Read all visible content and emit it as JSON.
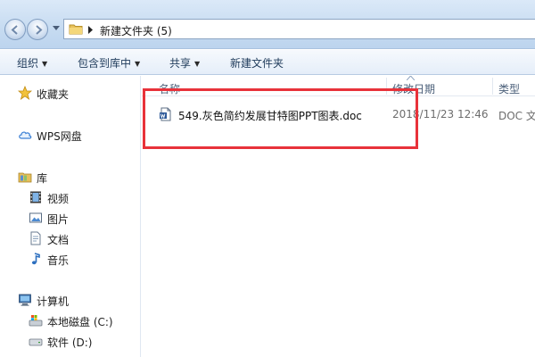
{
  "address_bar": {
    "path_segment": "新建文件夹 (5)",
    "icons": [
      "back-arrow-icon",
      "forward-arrow-icon",
      "folder-icon"
    ]
  },
  "toolbar": {
    "organize": "组织",
    "include_in_library": "包含到库中",
    "share": "共享",
    "new_folder": "新建文件夹"
  },
  "nav": {
    "favorites": "收藏夹",
    "wps_disk": "WPS网盘",
    "libraries": "库",
    "videos": "视频",
    "pictures": "图片",
    "documents": "文档",
    "music": "音乐",
    "computer": "计算机",
    "local_disk_c": "本地磁盘 (C:)",
    "software_d": "软件 (D:)"
  },
  "columns": {
    "name": "名称",
    "modified": "修改日期",
    "type": "类型"
  },
  "files": [
    {
      "name": "549.灰色简约发展甘特图PPT图表.doc",
      "modified": "2018/11/23 12:46",
      "type": "DOC 文",
      "icon": "word-doc-icon"
    }
  ],
  "colors": {
    "highlight": "#e8323a",
    "toolbar_text": "#1e3a5a",
    "header_text": "#4c607a"
  }
}
